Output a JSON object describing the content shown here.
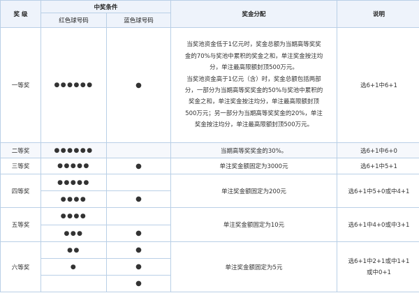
{
  "header": {
    "level": "奖 级",
    "condition": "中奖条件",
    "red": "红色球号码",
    "blue": "蓝色球号码",
    "distribution": "奖金分配",
    "note": "说明"
  },
  "rows": {
    "first": {
      "level": "一等奖",
      "red": "●●●●●●",
      "blue": "●",
      "desc": [
        "当奖池资金低于1亿元时，奖金总额为当期高等奖奖",
        "金的70%与奖池中累积的奖金之和，单注奖金按注均",
        "分，单注最高限额封顶500万元。",
        "当奖池资金高于1亿元（含）时，奖金总额包括两部",
        "分，一部分为当期高等奖奖金的50%与奖池中累积的",
        "奖金之和，单注奖金按注均分，单注最高限额封顶",
        "500万元；另一部分为当期高等奖奖金的20%，单注",
        "奖金按注均分，单注最高限额封顶500万元。"
      ],
      "note": "选6+1中6+1"
    },
    "second": {
      "level": "二等奖",
      "red": "●●●●●●",
      "blue": "",
      "desc": "当期高等奖奖金的30%。",
      "note": "选6+1中6+0"
    },
    "third": {
      "level": "三等奖",
      "red": "●●●●●",
      "blue": "●",
      "desc": "单注奖金额固定为3000元",
      "note": "选6+1中5+1"
    },
    "fourth": {
      "level": "四等奖",
      "red": [
        "●●●●●",
        "●●●●"
      ],
      "blue": [
        "",
        "●"
      ],
      "desc": "单注奖金额固定为200元",
      "note": "选6+1中5+0或中4+1"
    },
    "fifth": {
      "level": "五等奖",
      "red": [
        "●●●●",
        "●●●"
      ],
      "blue": [
        "",
        "●"
      ],
      "desc": "单注奖金额固定为10元",
      "note": "选6+1中4+0或中3+1"
    },
    "sixth": {
      "level": "六等奖",
      "red": [
        "●●",
        "●",
        ""
      ],
      "blue": [
        "●",
        "●",
        "●"
      ],
      "desc": "单注奖金额固定为5元",
      "note": "选6+1中2+1或中1+1或中0+1"
    }
  }
}
